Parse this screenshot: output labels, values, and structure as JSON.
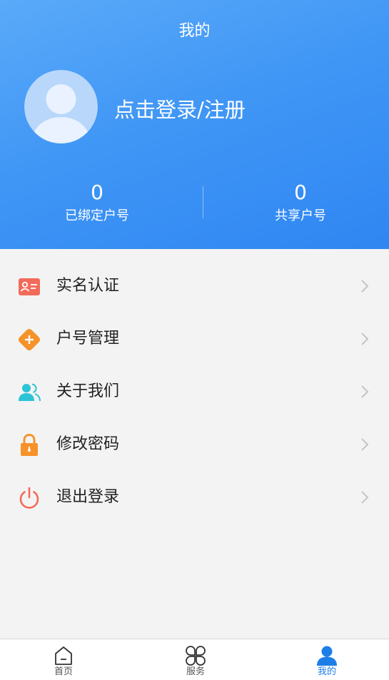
{
  "header": {
    "title": "我的",
    "login_text": "点击登录/注册",
    "stats": {
      "bound": {
        "value": "0",
        "label": "已绑定户号"
      },
      "shared": {
        "value": "0",
        "label": "共享户号"
      }
    }
  },
  "menu": {
    "items": [
      {
        "label": "实名认证",
        "icon": "id-card-icon",
        "color": "#f26b5a"
      },
      {
        "label": "户号管理",
        "icon": "plus-diamond-icon",
        "color": "#f5922a"
      },
      {
        "label": "关于我们",
        "icon": "users-icon",
        "color": "#2bc4d6"
      },
      {
        "label": "修改密码",
        "icon": "lock-icon",
        "color": "#f5922a"
      },
      {
        "label": "退出登录",
        "icon": "power-icon",
        "color": "#f26b5a"
      }
    ]
  },
  "tabbar": {
    "tabs": [
      {
        "label": "首页",
        "icon": "home-icon"
      },
      {
        "label": "服务",
        "icon": "grid-icon"
      },
      {
        "label": "我的",
        "icon": "user-icon",
        "active": true
      }
    ],
    "active_color": "#1e7ee8"
  },
  "colors": {
    "header_gradient_start": "#5aaaf9",
    "header_gradient_end": "#2f86f2",
    "background": "#f3f3f3"
  }
}
